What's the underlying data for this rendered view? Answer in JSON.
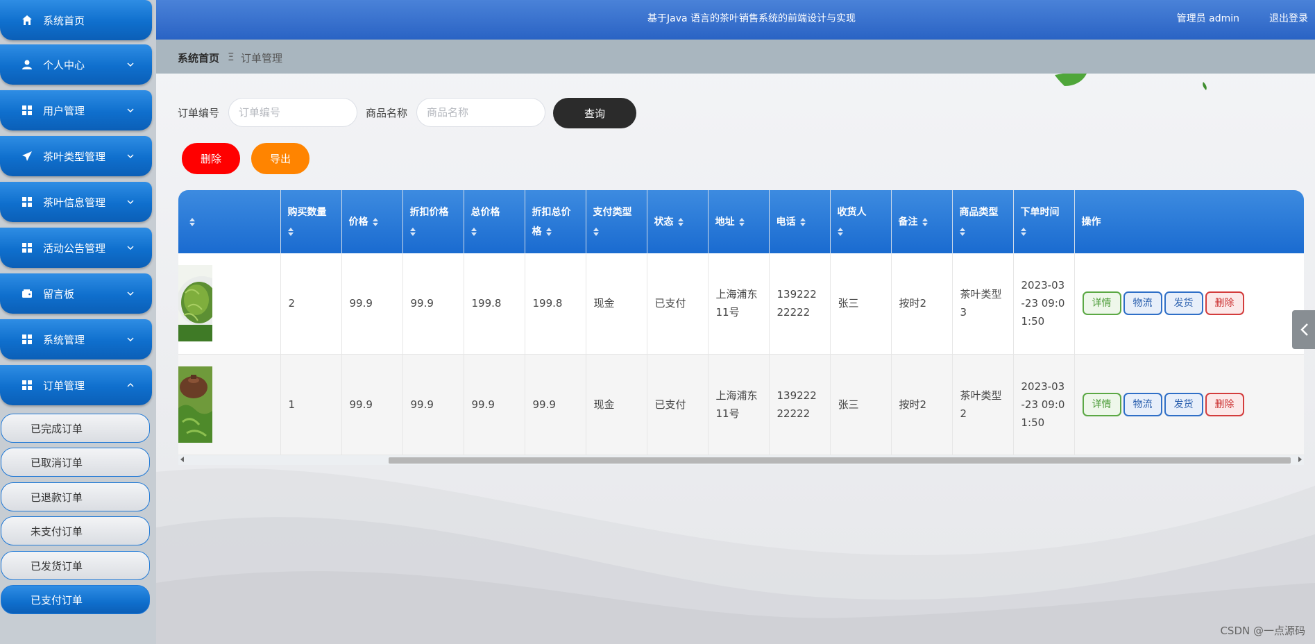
{
  "header": {
    "title": "基于Java 语言的茶叶销售系统的前端设计与实现",
    "user": "管理员 admin",
    "logout": "退出登录"
  },
  "breadcrumb": {
    "home": "系统首页",
    "separator": "Ξ",
    "current": "订单管理"
  },
  "sidebar": {
    "items": [
      {
        "label": "系统首页",
        "icon": "home-icon"
      },
      {
        "label": "个人中心",
        "icon": "user-icon"
      },
      {
        "label": "用户管理",
        "icon": "grid-icon"
      },
      {
        "label": "茶叶类型管理",
        "icon": "send-icon"
      },
      {
        "label": "茶叶信息管理",
        "icon": "grid-icon"
      },
      {
        "label": "活动公告管理",
        "icon": "grid-icon"
      },
      {
        "label": "留言板",
        "icon": "wallet-icon"
      },
      {
        "label": "系统管理",
        "icon": "grid-icon"
      },
      {
        "label": "订单管理",
        "icon": "grid-icon"
      }
    ],
    "subitems": [
      {
        "label": "已完成订单"
      },
      {
        "label": "已取消订单"
      },
      {
        "label": "已退款订单"
      },
      {
        "label": "未支付订单"
      },
      {
        "label": "已发货订单"
      },
      {
        "label": "已支付订单"
      }
    ]
  },
  "search": {
    "order_label": "订单编号",
    "order_placeholder": "订单编号",
    "product_label": "商品名称",
    "product_placeholder": "商品名称",
    "query_button": "查询"
  },
  "actions": {
    "delete": "删除",
    "export": "导出"
  },
  "table": {
    "headers": [
      "",
      "购买数量",
      "价格",
      "折扣价格",
      "总价格",
      "折扣总价格",
      "支付类型",
      "状态",
      "地址",
      "电话",
      "收货人",
      "备注",
      "商品类型",
      "下单时间",
      "操作"
    ],
    "rows": [
      {
        "image": "green-tea-image",
        "quantity": "2",
        "price": "99.9",
        "discount_price": "99.9",
        "total": "199.8",
        "discount_total": "199.8",
        "pay_type": "现金",
        "status": "已支付",
        "address": "上海浦东11号",
        "phone": "13922222222",
        "receiver": "张三",
        "remark": "按时2",
        "category": "茶叶类型3",
        "time": "2023-03-23 09:01:50"
      },
      {
        "image": "teapot-image",
        "quantity": "1",
        "price": "99.9",
        "discount_price": "99.9",
        "total": "99.9",
        "discount_total": "99.9",
        "pay_type": "现金",
        "status": "已支付",
        "address": "上海浦东11号",
        "phone": "13922222222",
        "receiver": "张三",
        "remark": "按时2",
        "category": "茶叶类型2",
        "time": "2023-03-23 09:01:50"
      }
    ],
    "op_buttons": {
      "detail": "详情",
      "logistics": "物流",
      "ship": "发货",
      "delete": "删除"
    }
  },
  "watermark": "CSDN @一点源码"
}
